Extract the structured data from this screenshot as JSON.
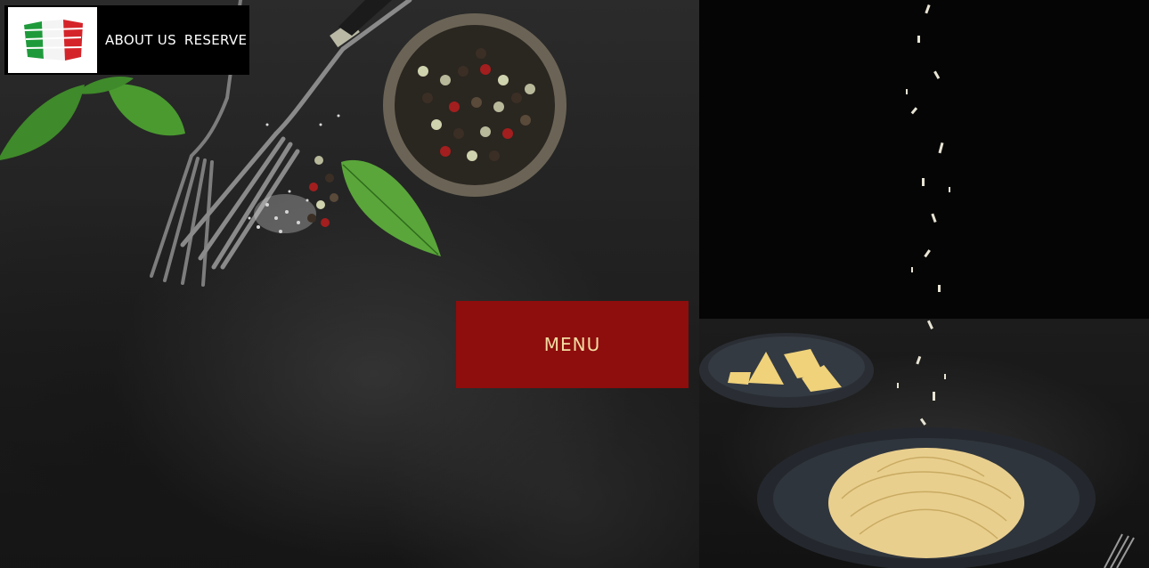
{
  "nav": {
    "logo_alt": "Italian flag logo",
    "items": [
      {
        "label": "ABOUT US"
      },
      {
        "label": "RESERVE"
      }
    ]
  },
  "hero": {
    "cta_label": "MENU"
  },
  "colors": {
    "cta_background": "#8e0d0d",
    "cta_text": "#f3dca2",
    "nav_background": "#000000",
    "flag_green": "#1f9a3b",
    "flag_red": "#d4242a"
  }
}
